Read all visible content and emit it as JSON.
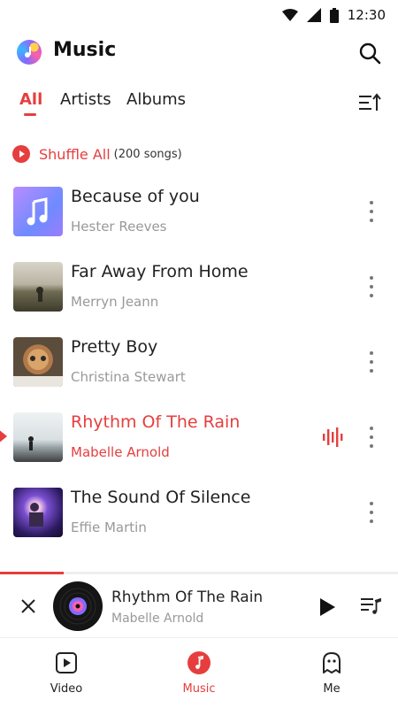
{
  "status_bar": {
    "time": "12:30",
    "icons": [
      "wifi-icon",
      "signal-icon",
      "battery-icon"
    ]
  },
  "app_bar": {
    "title": "Music",
    "logo": "music-app-logo",
    "search_icon": "search-icon"
  },
  "tabs": [
    {
      "label": "All",
      "active": true
    },
    {
      "label": "Artists",
      "active": false
    },
    {
      "label": "Albums",
      "active": false
    }
  ],
  "sort_icon": "sort-icon",
  "shuffle": {
    "label": "Shuffle All",
    "count": "(200 songs)",
    "icon": "play-circle-icon"
  },
  "songs": [
    {
      "title": "Because of you",
      "artist": "Hester Reeves",
      "artwork": "music-note-gradient",
      "playing": false
    },
    {
      "title": "Far Away From Home",
      "artist": "Merryn Jeann",
      "artwork": "photo-landscape-figure",
      "playing": false
    },
    {
      "title": "Pretty Boy",
      "artist": "Christina Stewart",
      "artwork": "photo-cat",
      "playing": false
    },
    {
      "title": "Rhythm Of The Rain",
      "artist": "Mabelle Arnold",
      "artwork": "photo-seaside-figure",
      "playing": true
    },
    {
      "title": "The Sound Of Silence",
      "artist": "Effie Martin",
      "artwork": "photo-concert",
      "playing": false
    }
  ],
  "mini_player": {
    "title": "Rhythm Of The Rain",
    "artist": "Mabelle Arnold",
    "progress": 0.16
  },
  "bottom_nav": [
    {
      "label": "Video",
      "icon": "video-play-icon",
      "active": false
    },
    {
      "label": "Music",
      "icon": "music-note-icon",
      "active": true
    },
    {
      "label": "Me",
      "icon": "profile-ghost-icon",
      "active": false
    }
  ],
  "colors": {
    "accent": "#e63e3e",
    "text": "#222222",
    "secondary": "#999999"
  }
}
